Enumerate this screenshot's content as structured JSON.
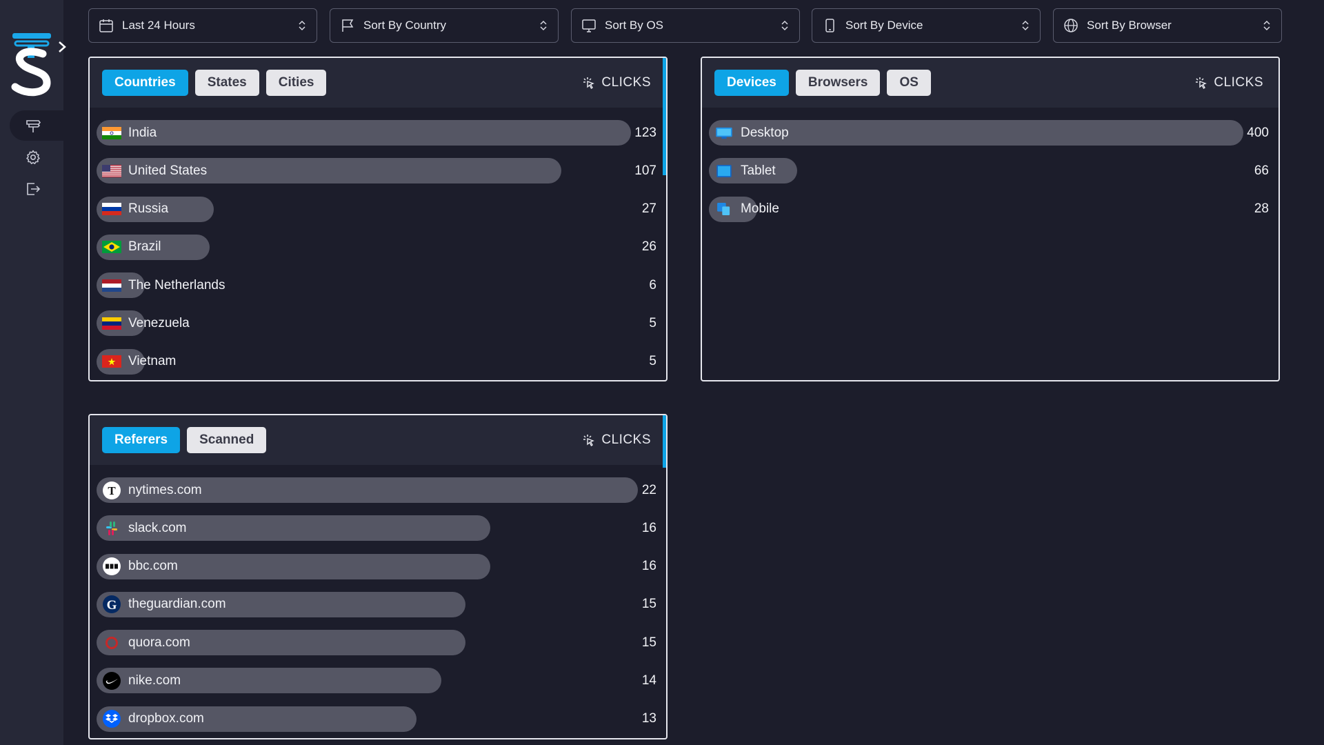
{
  "filters": [
    {
      "label": "Last 24 Hours",
      "icon": "calendar-icon"
    },
    {
      "label": "Sort By Country",
      "icon": "flag-icon"
    },
    {
      "label": "Sort By OS",
      "icon": "monitor-icon"
    },
    {
      "label": "Sort By Device",
      "icon": "phone-icon"
    },
    {
      "label": "Sort By Browser",
      "icon": "globe-icon"
    }
  ],
  "sidebar": {
    "items": [
      {
        "name": "links",
        "icon": "signpost-icon",
        "active": true
      },
      {
        "name": "settings",
        "icon": "gear-icon",
        "active": false
      },
      {
        "name": "logout",
        "icon": "logout-icon",
        "active": false
      }
    ]
  },
  "location_card": {
    "tabs": [
      "Countries",
      "States",
      "Cities"
    ],
    "active_tab": 0,
    "metric": "CLICKS",
    "max": 123,
    "rows": [
      {
        "label": "India",
        "value": 123,
        "icon": "flag-india"
      },
      {
        "label": "United States",
        "value": 107,
        "icon": "flag-us"
      },
      {
        "label": "Russia",
        "value": 27,
        "icon": "flag-russia"
      },
      {
        "label": "Brazil",
        "value": 26,
        "icon": "flag-brazil"
      },
      {
        "label": "The Netherlands",
        "value": 6,
        "icon": "flag-netherlands"
      },
      {
        "label": "Venezuela",
        "value": 5,
        "icon": "flag-venezuela"
      },
      {
        "label": "Vietnam",
        "value": 5,
        "icon": "flag-vietnam"
      }
    ]
  },
  "device_card": {
    "tabs": [
      "Devices",
      "Browsers",
      "OS"
    ],
    "active_tab": 0,
    "metric": "CLICKS",
    "max": 400,
    "rows": [
      {
        "label": "Desktop",
        "value": 400,
        "icon": "desktop-icon"
      },
      {
        "label": "Tablet",
        "value": 66,
        "icon": "tablet-icon"
      },
      {
        "label": "Mobile",
        "value": 28,
        "icon": "mobile-icon"
      }
    ]
  },
  "referrer_card": {
    "tabs": [
      "Referers",
      "Scanned"
    ],
    "active_tab": 0,
    "metric": "CLICKS",
    "max": 22,
    "rows": [
      {
        "label": "nytimes.com",
        "value": 22,
        "icon": "nytimes-icon"
      },
      {
        "label": "slack.com",
        "value": 16,
        "icon": "slack-icon"
      },
      {
        "label": "bbc.com",
        "value": 16,
        "icon": "bbc-icon"
      },
      {
        "label": "theguardian.com",
        "value": 15,
        "icon": "guardian-icon"
      },
      {
        "label": "quora.com",
        "value": 15,
        "icon": "quora-icon"
      },
      {
        "label": "nike.com",
        "value": 14,
        "icon": "nike-icon"
      },
      {
        "label": "dropbox.com",
        "value": 13,
        "icon": "dropbox-icon"
      }
    ]
  },
  "colors": {
    "accent": "#0ea4e6",
    "background": "#1c1d2b",
    "panel": "#262837",
    "bar": "#555664"
  }
}
